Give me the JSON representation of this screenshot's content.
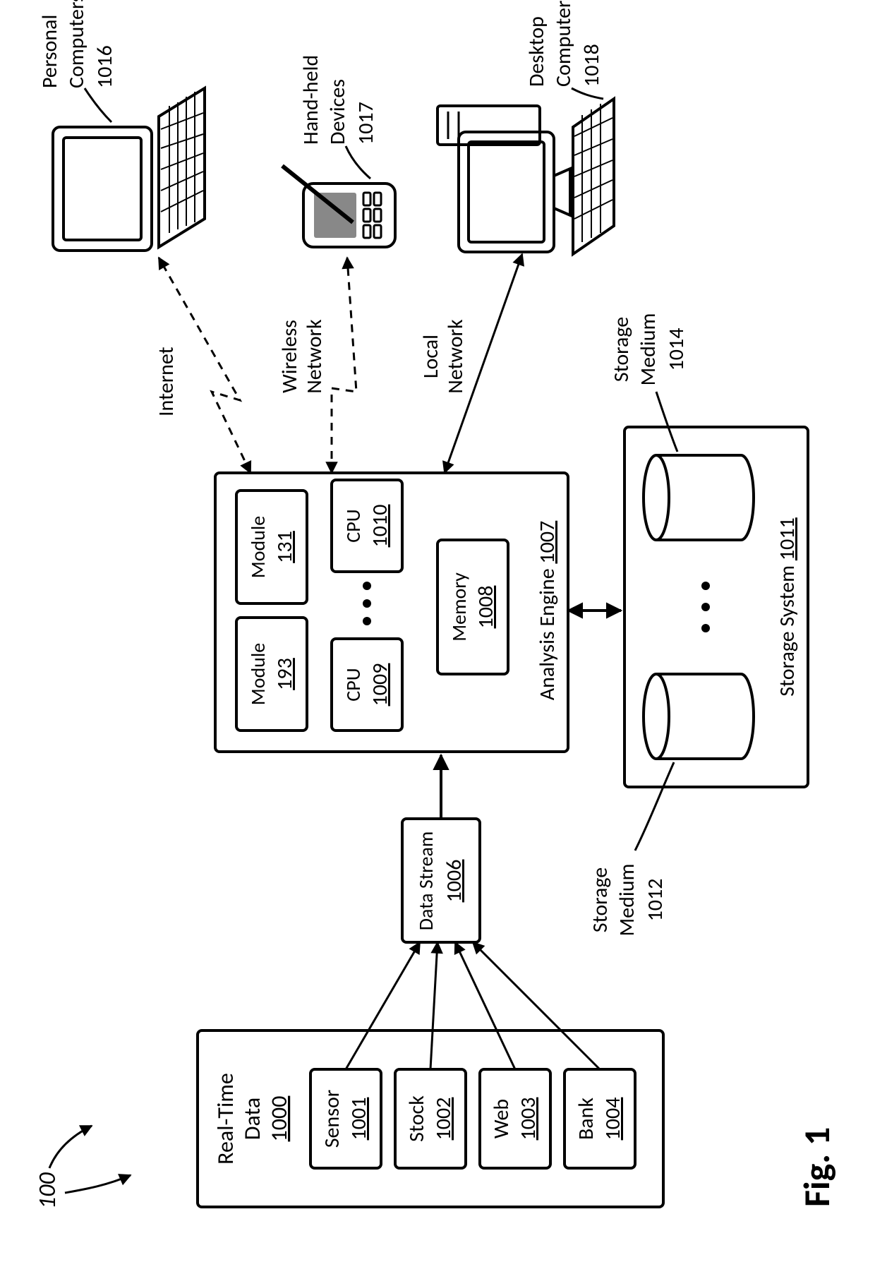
{
  "figure_ref": "100",
  "figure_label": "Fig. 1",
  "realtime": {
    "header": {
      "line1": "Real-Time",
      "line2": "Data",
      "ref": "1000"
    },
    "items": [
      {
        "name": "Sensor",
        "ref": "1001"
      },
      {
        "name": "Stock",
        "ref": "1002"
      },
      {
        "name": "Web",
        "ref": "1003"
      },
      {
        "name": "Bank",
        "ref": "1004"
      }
    ]
  },
  "data_stream": {
    "name": "Data Stream",
    "ref": "1006"
  },
  "engine": {
    "title": "Analysis Engine",
    "ref": "1007",
    "module_a": {
      "name": "Module",
      "ref": "193"
    },
    "module_b": {
      "name": "Module",
      "ref": "131"
    },
    "cpu_a": {
      "name": "CPU",
      "ref": "1009"
    },
    "cpu_b": {
      "name": "CPU",
      "ref": "1010"
    },
    "memory": {
      "name": "Memory",
      "ref": "1008"
    }
  },
  "storage": {
    "title": "Storage System",
    "ref": "1011",
    "medium_a": {
      "name": "Storage",
      "name2": "Medium",
      "ref": "1012"
    },
    "medium_b": {
      "name": "Storage",
      "name2": "Medium",
      "ref": "1014"
    }
  },
  "networks": {
    "internet": "Internet",
    "wireless": {
      "line1": "Wireless",
      "line2": "Network"
    },
    "local": {
      "line1": "Local",
      "line2": "Network"
    }
  },
  "pc": {
    "line1": "Personal",
    "line2": "Computers",
    "ref": "1016"
  },
  "handheld": {
    "line1": "Hand-held",
    "line2": "Devices",
    "ref": "1017"
  },
  "desktop": {
    "line1": "Desktop",
    "line2": "Computers",
    "ref": "1018"
  },
  "ellipsis": "• • •"
}
